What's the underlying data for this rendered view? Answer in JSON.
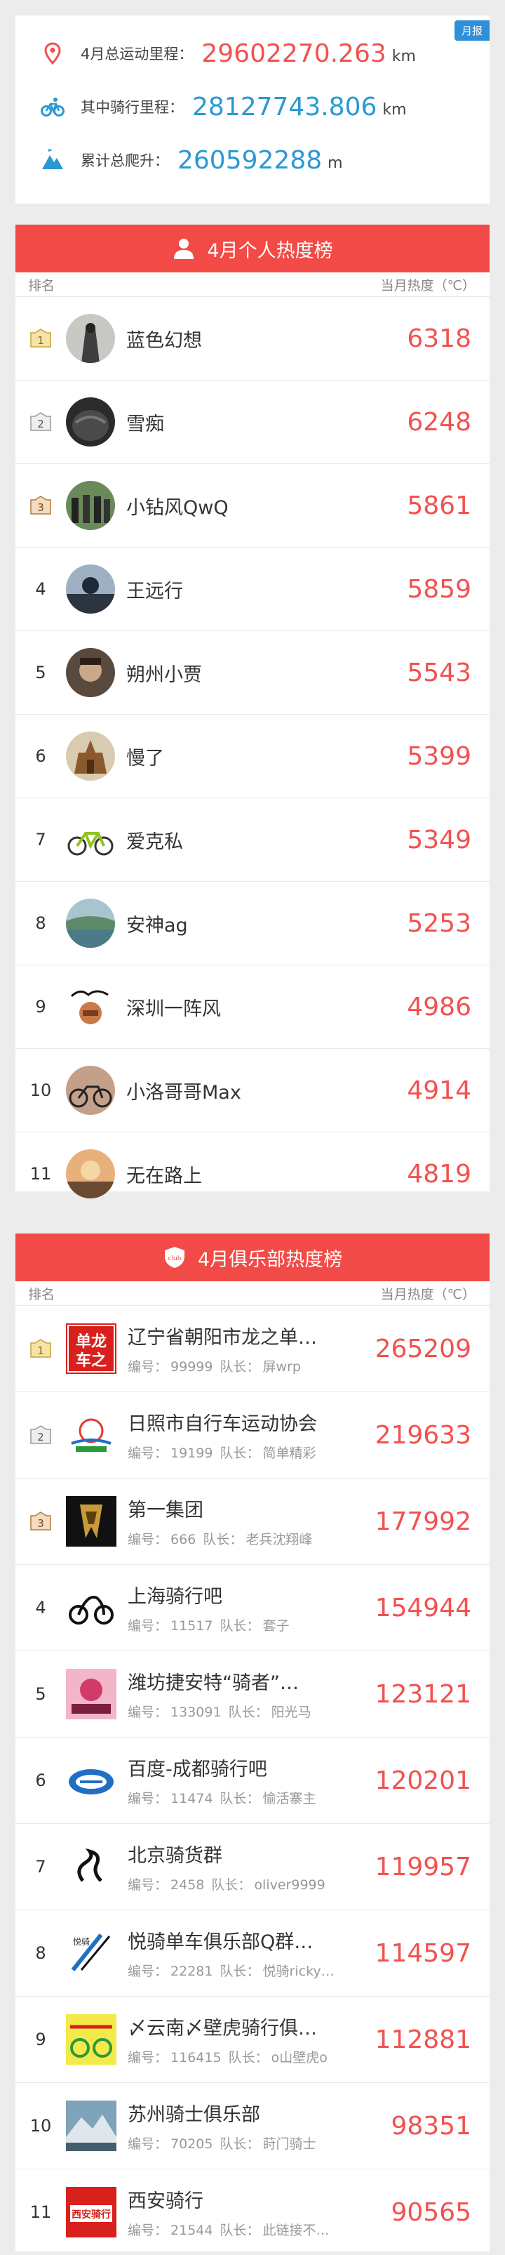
{
  "summary": {
    "badge": "月报",
    "total_label": "4月总运动里程：",
    "total_value": "29602270.263",
    "total_unit": "km",
    "ride_label": "其中骑行里程：",
    "ride_value": "28127743.806",
    "ride_unit": "km",
    "climb_label": "累计总爬升：",
    "climb_value": "260592288",
    "climb_unit": "m",
    "colors": {
      "accent_red": "#f2514f",
      "accent_blue": "#2a99d2"
    },
    "icons": [
      "location-pin-icon",
      "bicycle-icon",
      "mountain-icon"
    ]
  },
  "personal": {
    "title": "4月个人热度榜",
    "col_rank": "排名",
    "col_heat": "当月热度（℃）",
    "rows": [
      {
        "rank": "1",
        "name": "蓝色幻想",
        "heat": "6318"
      },
      {
        "rank": "2",
        "name": "雪痴",
        "heat": "6248"
      },
      {
        "rank": "3",
        "name": "小钻风QwQ",
        "heat": "5861"
      },
      {
        "rank": "4",
        "name": "王远行",
        "heat": "5859"
      },
      {
        "rank": "5",
        "name": "朔州小贾",
        "heat": "5543"
      },
      {
        "rank": "6",
        "name": "慢了",
        "heat": "5399"
      },
      {
        "rank": "7",
        "name": "爱克私",
        "heat": "5349"
      },
      {
        "rank": "8",
        "name": "安神ag",
        "heat": "5253"
      },
      {
        "rank": "9",
        "name": "深圳一阵风",
        "heat": "4986"
      },
      {
        "rank": "10",
        "name": "小洛哥哥Max",
        "heat": "4914"
      },
      {
        "rank": "11",
        "name": "无在路上",
        "heat": "4819"
      }
    ]
  },
  "clubs": {
    "title": "4月俱乐部热度榜",
    "col_rank": "排名",
    "col_heat": "当月热度（℃）",
    "id_label": "编号：",
    "leader_label": "队长：",
    "rows": [
      {
        "rank": "1",
        "name": "辽宁省朝阳市龙之单…",
        "id": "99999",
        "leader": "屏wrp",
        "heat": "265209"
      },
      {
        "rank": "2",
        "name": "日照市自行车运动协会",
        "id": "19199",
        "leader": "简单精彩",
        "heat": "219633"
      },
      {
        "rank": "3",
        "name": "第一集团",
        "id": "666",
        "leader": "老兵沈翔峰",
        "heat": "177992"
      },
      {
        "rank": "4",
        "name": "上海骑行吧",
        "id": "11517",
        "leader": "套子",
        "heat": "154944"
      },
      {
        "rank": "5",
        "name": "潍坊捷安特“骑者”…",
        "id": "133091",
        "leader": "阳光马",
        "heat": "123121"
      },
      {
        "rank": "6",
        "name": "百度-成都骑行吧",
        "id": "11474",
        "leader": "愉活寨主",
        "heat": "120201"
      },
      {
        "rank": "7",
        "name": "北京骑货群",
        "id": "2458",
        "leader": "oliver9999",
        "heat": "119957"
      },
      {
        "rank": "8",
        "name": "悦骑单车俱乐部Q群…",
        "id": "22281",
        "leader": "悦骑ricky…",
        "heat": "114597"
      },
      {
        "rank": "9",
        "name": "〆云南〆壁虎骑行俱…",
        "id": "116415",
        "leader": "o山壁虎o",
        "heat": "112881"
      },
      {
        "rank": "10",
        "name": "苏州骑士俱乐部",
        "id": "70205",
        "leader": "莳门骑士",
        "heat": "98351"
      },
      {
        "rank": "11",
        "name": "西安骑行",
        "id": "21544",
        "leader": "此链接不…",
        "heat": "90565"
      }
    ],
    "logo_texts": {
      "club1": "单龙车之",
      "club11": "西安骑行"
    }
  }
}
